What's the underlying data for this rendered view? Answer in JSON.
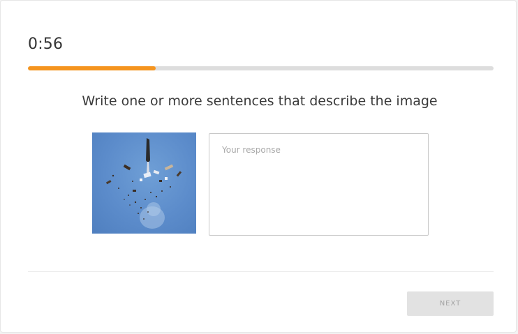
{
  "timer": {
    "text": "0:56"
  },
  "progress": {
    "fraction": 0.275,
    "fill_color": "#f5941e",
    "track_color": "#dddddd"
  },
  "question": {
    "prompt": "Write one or more sentences that describe the image"
  },
  "image": {
    "subject": "explosion-debris-in-blue-sky"
  },
  "response": {
    "placeholder": "Your response",
    "value": ""
  },
  "footer": {
    "next_label": "NEXT",
    "next_enabled": false
  }
}
